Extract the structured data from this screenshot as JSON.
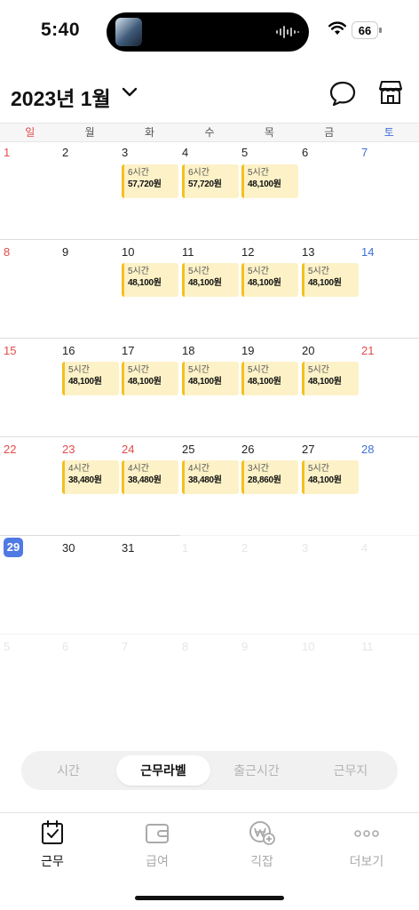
{
  "status": {
    "time": "5:40",
    "battery": "66"
  },
  "header": {
    "month_title": "2023년 1월"
  },
  "weekdays": [
    "일",
    "월",
    "화",
    "수",
    "목",
    "금",
    "토"
  ],
  "weeks": [
    {
      "days": [
        "1",
        "2",
        "3",
        "4",
        "5",
        "6",
        "7"
      ]
    },
    {
      "days": [
        "8",
        "9",
        "10",
        "11",
        "12",
        "13",
        "14"
      ]
    },
    {
      "days": [
        "15",
        "16",
        "17",
        "18",
        "19",
        "20",
        "21"
      ]
    },
    {
      "days": [
        "22",
        "23",
        "24",
        "25",
        "26",
        "27",
        "28"
      ]
    },
    {
      "days": [
        "29",
        "30",
        "31",
        "1",
        "2",
        "3",
        "4"
      ]
    },
    {
      "days": [
        "5",
        "6",
        "7",
        "8",
        "9",
        "10",
        "11"
      ]
    }
  ],
  "shifts": [
    {
      "hours": "6시간",
      "wage": "57,720원"
    },
    {
      "hours": "6시간",
      "wage": "57,720원"
    },
    {
      "hours": "5시간",
      "wage": "48,100원"
    },
    {
      "hours": "5시간",
      "wage": "48,100원"
    },
    {
      "hours": "5시간",
      "wage": "48,100원"
    },
    {
      "hours": "5시간",
      "wage": "48,100원"
    },
    {
      "hours": "5시간",
      "wage": "48,100원"
    },
    {
      "hours": "5시간",
      "wage": "48,100원"
    },
    {
      "hours": "5시간",
      "wage": "48,100원"
    },
    {
      "hours": "5시간",
      "wage": "48,100원"
    },
    {
      "hours": "5시간",
      "wage": "48,100원"
    },
    {
      "hours": "5시간",
      "wage": "48,100원"
    },
    {
      "hours": "4시간",
      "wage": "38,480원"
    },
    {
      "hours": "4시간",
      "wage": "38,480원"
    },
    {
      "hours": "4시간",
      "wage": "38,480원"
    },
    {
      "hours": "3시간",
      "wage": "28,860원"
    },
    {
      "hours": "5시간",
      "wage": "48,100원"
    }
  ],
  "segment": {
    "options": [
      "시간",
      "근무라벨",
      "출근시간",
      "근무지"
    ],
    "selected": "근무라벨"
  },
  "tabs": [
    {
      "label": "근무",
      "icon": "calendar-check-icon"
    },
    {
      "label": "급여",
      "icon": "wallet-icon"
    },
    {
      "label": "긱잡",
      "icon": "won-coin-plus-icon"
    },
    {
      "label": "더보기",
      "icon": "more-dots-icon"
    }
  ],
  "colors": {
    "accent": "#4f79e3",
    "sunday": "#e24b4b",
    "saturday": "#3f6fd8",
    "chip_bg": "#fdf2c7",
    "chip_bar": "#f3c020"
  }
}
